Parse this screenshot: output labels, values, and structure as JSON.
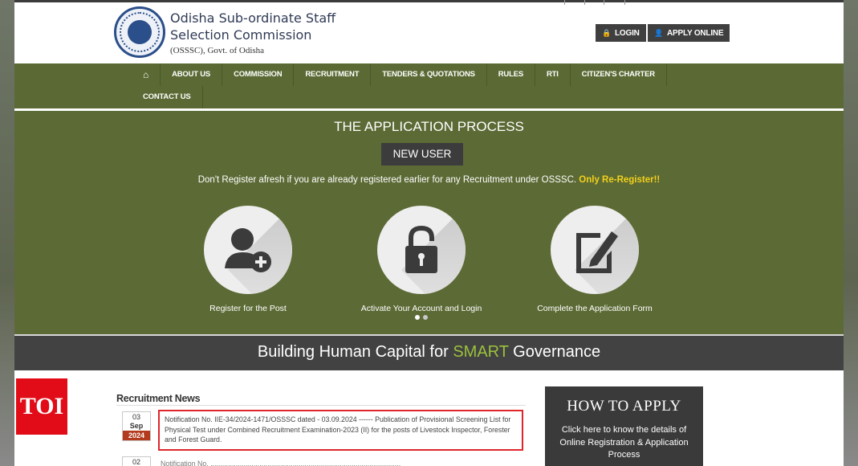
{
  "header": {
    "org_name_line1": "Odisha Sub-ordinate Staff",
    "org_name_line2": "Selection Commission",
    "org_sub": "(OSSSC), Govt. of Odisha",
    "login_label": "LOGIN",
    "apply_label": "APPLY ONLINE"
  },
  "nav": {
    "items": [
      "ABOUT US",
      "COMMISSION",
      "RECRUITMENT",
      "TENDERS & QUOTATIONS",
      "RULES",
      "RTI",
      "CITIZEN'S CHARTER",
      "CONTACT US"
    ]
  },
  "hero": {
    "title": "THE APPLICATION PROCESS",
    "new_user_label": "NEW USER",
    "notice": "Don't Register afresh if you are already registered earlier for any Recruitment under OSSSC.",
    "notice_highlight": "Only Re-Register!!",
    "steps": [
      {
        "label": "Register for the Post",
        "icon": "add-user-icon"
      },
      {
        "label": "Activate Your Account and Login",
        "icon": "lock-icon"
      },
      {
        "label": "Complete the Application Form",
        "icon": "edit-form-icon"
      }
    ],
    "carousel": {
      "current": 1,
      "total": 2
    }
  },
  "tagline": {
    "before": "Building Human Capital for",
    "highlight": "SMART",
    "after": "Governance"
  },
  "badge": {
    "text": "TOI"
  },
  "news": {
    "heading": "Recruitment News",
    "items": [
      {
        "day": "03",
        "month": "Sep",
        "year": "2024",
        "text": "Notification No. IIE-34/2024-1471/OSSSC dated - 03.09.2024 ------ Publication of Provisional Screening List for Physical Test under Combined Recruitment Examination-2023 (II) for the posts of Livestock Inspector, Forester and Forest Guard."
      },
      {
        "day": "02",
        "text": "Notification No. ................................................................................................."
      }
    ]
  },
  "how_to_apply": {
    "title": "HOW TO APPLY",
    "text": "Click here to know the details of Online Registration & Application Process"
  },
  "colors": {
    "nav_green": "#5b6a34",
    "dark_button": "#3f3f3f",
    "smart_green": "#9cc13c",
    "highlight_yellow": "#f2d11b",
    "news_border_red": "#e0262b",
    "toi_red": "#e10c17"
  }
}
